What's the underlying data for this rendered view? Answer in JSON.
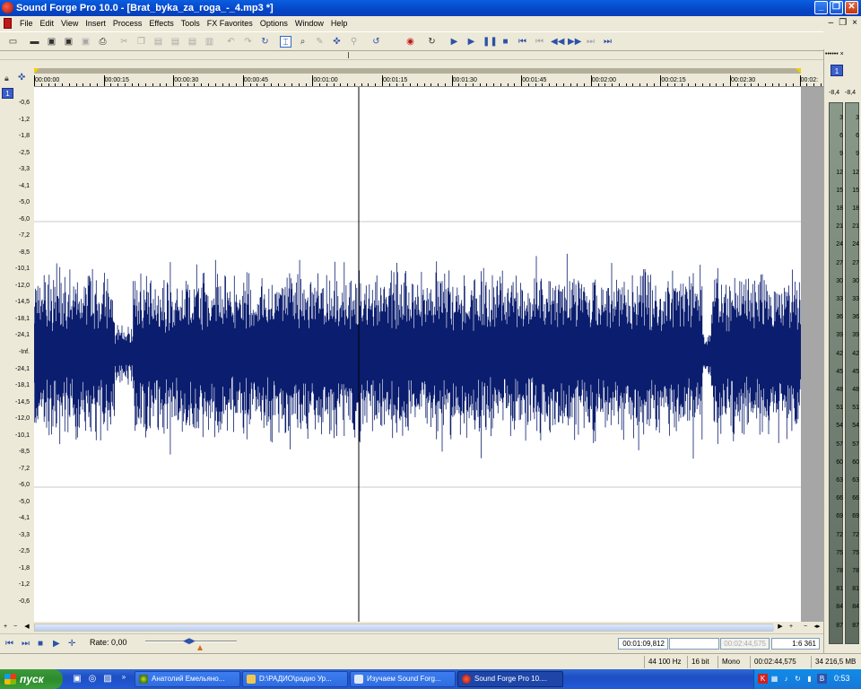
{
  "window": {
    "title": "Sound Forge Pro 10.0 - [Brat_byka_za_roga_-_4.mp3 *]",
    "min_label": "_",
    "max_label": "❐",
    "close_label": "✕"
  },
  "menu": {
    "items": [
      "File",
      "Edit",
      "View",
      "Insert",
      "Process",
      "Effects",
      "Tools",
      "FX Favorites",
      "Options",
      "Window",
      "Help"
    ],
    "mdi_min": "–",
    "mdi_restore": "❐",
    "mdi_close": "×"
  },
  "toolbar": {
    "icons": [
      "new-icon",
      "open-icon",
      "save-icon",
      "save-as-icon",
      "save-all-icon",
      "print-icon",
      "cut-icon",
      "copy-icon",
      "paste-icon",
      "paste-special-icon",
      "mix-icon",
      "crop-icon",
      "undo-icon",
      "redo-icon",
      "repeat-icon",
      "edit-tool-icon",
      "magnify-tool-icon",
      "pencil-tool-icon",
      "envelope-tool-icon",
      "event-tool-icon",
      "refresh-icon",
      "record-icon",
      "loop-icon",
      "play-all-icon",
      "play-icon",
      "pause-icon",
      "stop-icon",
      "go-start-icon",
      "rewind-icon",
      "rewind-fast-icon",
      "forward-fast-icon",
      "forward-icon",
      "go-end-icon"
    ]
  },
  "channel": {
    "badge": "1"
  },
  "db_scale": [
    "-0,6",
    "-1,2",
    "-1,8",
    "-2,5",
    "-3,3",
    "-4,1",
    "-5,0",
    "-6,0",
    "-7,2",
    "-8,5",
    "-10,1",
    "-12,0",
    "-14,5",
    "-18,1",
    "-24,1",
    "-Inf.",
    "-24,1",
    "-18,1",
    "-14,5",
    "-12,0",
    "-10,1",
    "-8,5",
    "-7,2",
    "-6,0",
    "-5,0",
    "-4,1",
    "-3,3",
    "-2,5",
    "-1,8",
    "-1,2",
    "-0,6"
  ],
  "ruler": {
    "labels": [
      "00:00:00",
      "00:00:15",
      "00:00:30",
      "00:00:45",
      "00:01:00",
      "00:01:15",
      "00:01:30",
      "00:01:45",
      "00:02:00",
      "00:02:15",
      "00:02:30",
      "00:02:"
    ]
  },
  "transport": {
    "rate_label": "Rate: 0,00",
    "cursor_position": "00:01:09,812",
    "selection_start": "",
    "selection_length": "00:02:44,575",
    "zoom_ratio": "1:6 361"
  },
  "meters": {
    "header": "••••••  ×",
    "badge": "1",
    "peak_left": "-8,4",
    "peak_right": "-8,4",
    "scale": [
      "3",
      "6",
      "9",
      "12",
      "15",
      "18",
      "21",
      "24",
      "27",
      "30",
      "33",
      "36",
      "39",
      "42",
      "45",
      "48",
      "51",
      "54",
      "57",
      "60",
      "63",
      "66",
      "69",
      "72",
      "75",
      "78",
      "81",
      "84",
      "87"
    ]
  },
  "status": {
    "sample_rate": "44 100 Hz",
    "bit_depth": "16 bit",
    "channels": "Mono",
    "length": "00:02:44,575",
    "disk_space": "34 216,5 MB"
  },
  "taskbar": {
    "start_label": "пуск",
    "tasks": [
      "Анатолий Емельяно...",
      "D:\\РАДИО\\радио Ур...",
      "Изучаем Sound Forg...",
      "Sound Forge Pro 10...."
    ],
    "clock": "0:53"
  },
  "colors": {
    "waveform": "#0b1d6e",
    "accent": "#316ac5",
    "taskbar": "#245ad8"
  }
}
